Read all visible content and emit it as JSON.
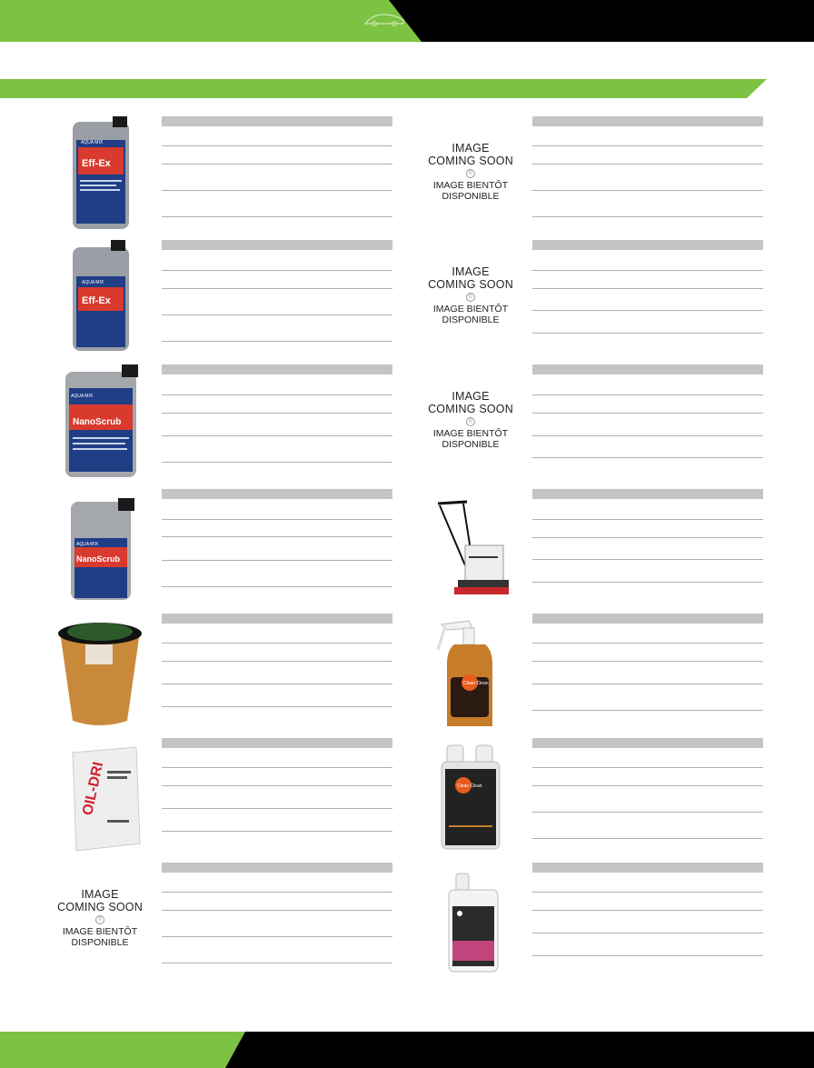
{
  "colors": {
    "brand_green": "#7dc242",
    "band_black": "#000000",
    "rule_grey": "#c4c4c4"
  },
  "placeholder": {
    "line1": "IMAGE",
    "line2": "COMING SOON",
    "line3": "IMAGE BIENTÔT",
    "line4": "DISPONIBLE"
  },
  "products": [
    {
      "id": "effex-large",
      "label_brand": "AQUA MIX",
      "label_name": "Eff-Ex"
    },
    {
      "id": "placeholder-1"
    },
    {
      "id": "effex-small",
      "label_brand": "AQUA MIX",
      "label_name": "Eff-Ex"
    },
    {
      "id": "placeholder-2"
    },
    {
      "id": "nanoscrub-small",
      "label_brand": "AQUA MIX",
      "label_name": "NanoScrub"
    },
    {
      "id": "placeholder-3"
    },
    {
      "id": "nanoscrub-large",
      "label_brand": "AQUA MIX",
      "label_name": "NanoScrub"
    },
    {
      "id": "floor-machine"
    },
    {
      "id": "absorbent-bucket"
    },
    {
      "id": "spray-bottle",
      "label_brand": "Clean Clean"
    },
    {
      "id": "oil-dri-bag",
      "label_name": "OIL-DRI"
    },
    {
      "id": "dual-bottle",
      "label_brand": "Clean Clean"
    },
    {
      "id": "placeholder-4"
    },
    {
      "id": "pink-bottle"
    }
  ]
}
